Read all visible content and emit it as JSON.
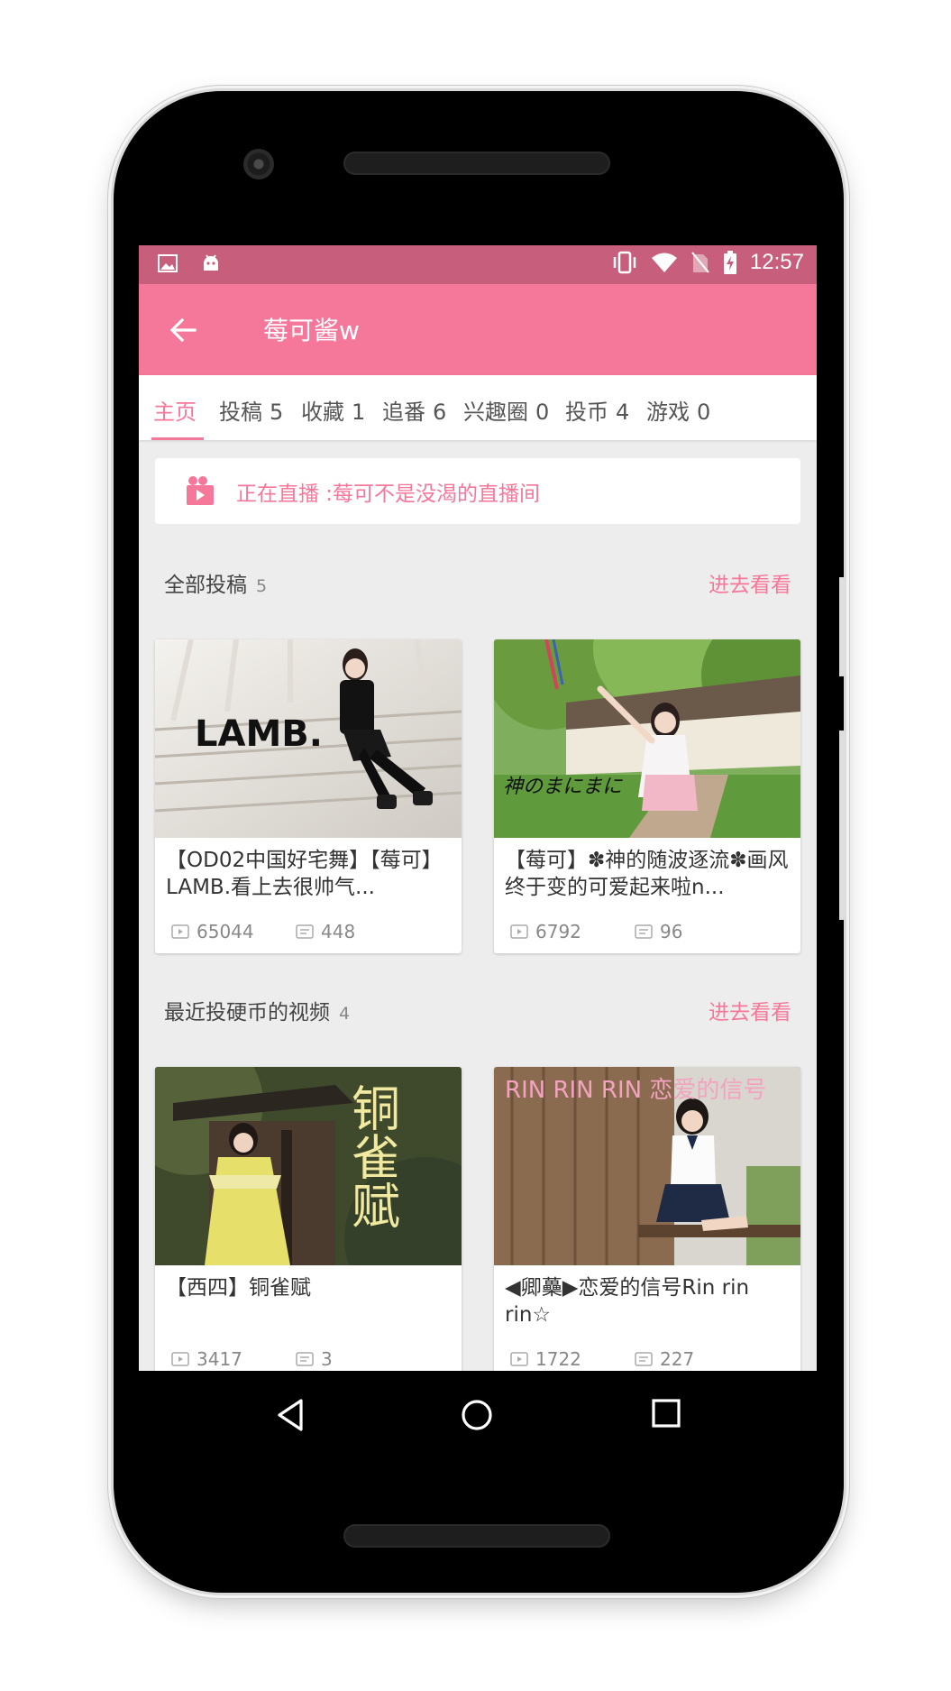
{
  "status_bar": {
    "time": "12:57"
  },
  "app_bar": {
    "title": "莓可酱w"
  },
  "tabs": [
    {
      "label": "主页",
      "count": ""
    },
    {
      "label": "投稿",
      "count": "5"
    },
    {
      "label": "收藏",
      "count": "1"
    },
    {
      "label": "追番",
      "count": "6"
    },
    {
      "label": "兴趣圈",
      "count": "0"
    },
    {
      "label": "投币",
      "count": "4"
    },
    {
      "label": "游戏",
      "count": "0"
    }
  ],
  "live": {
    "text": "正在直播 :莓可不是没渴的直播间"
  },
  "sections": [
    {
      "label": "全部投稿",
      "count": "5",
      "more": "进去看看",
      "videos": [
        {
          "title": "【OD02中国好宅舞】【莓可】LAMB.看上去很帅气...",
          "plays": "65044",
          "danmaku": "448",
          "thumb_text": "LAMB."
        },
        {
          "title": "【莓可】✽神的随波逐流✽画风终于变的可爱起来啦n...",
          "plays": "6792",
          "danmaku": "96",
          "thumb_text": "神のまにまに"
        }
      ]
    },
    {
      "label": "最近投硬币的视频",
      "count": "4",
      "more": "进去看看",
      "videos": [
        {
          "title": "【西四】铜雀赋",
          "plays": "3417",
          "danmaku": "3",
          "thumb_text": "铜雀赋"
        },
        {
          "title": "◀卿蘽▶恋爱的信号Rin rin rin☆",
          "plays": "1722",
          "danmaku": "227",
          "thumb_text": "RIN RIN RIN 恋爱的信号"
        }
      ]
    }
  ],
  "colors": {
    "accent": "#f57799",
    "status_bar": "#c75f7c",
    "background": "#ededed"
  }
}
